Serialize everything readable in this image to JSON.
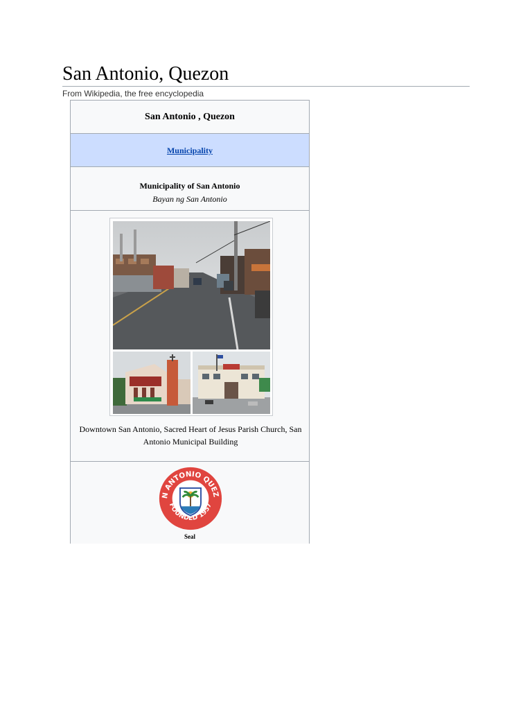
{
  "page": {
    "title": "San Antonio, Quezon",
    "tagline": "From Wikipedia, the free encyclopedia"
  },
  "infobox": {
    "title": "San Antonio , Quezon",
    "type_link": "Municipality",
    "official_name": "Municipality of San Antonio",
    "native_name": "Bayan ng San Antonio",
    "photo_caption": "Downtown San Antonio, Sacred Heart of Jesus Parish Church, San Antonio Municipal Building",
    "seal": {
      "ring_text_top": "SAN ANTONIO QUEZON",
      "ring_text_bottom": "FOUNDED 1957",
      "caption": "Seal"
    }
  },
  "colors": {
    "type_row_bg": "#ccddff",
    "link": "#0645ad",
    "infobox_bg": "#f8f9fa",
    "border": "#a2a9b1",
    "seal_red": "#e0453f"
  }
}
